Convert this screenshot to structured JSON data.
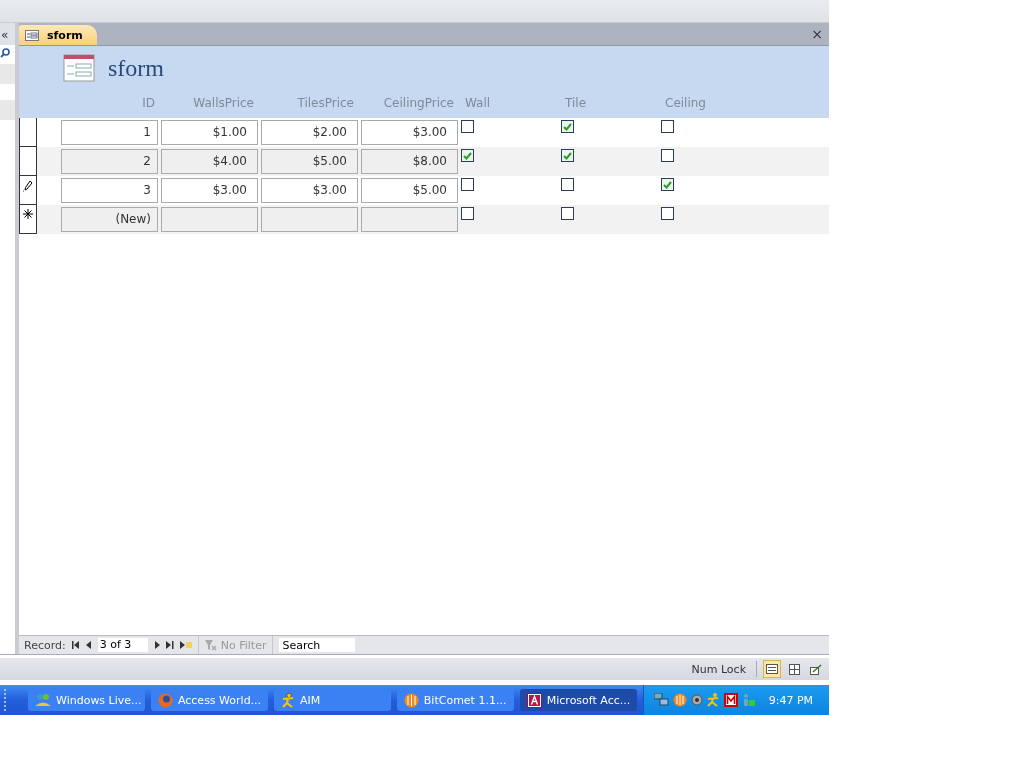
{
  "nav_pane": {
    "collapse": "«"
  },
  "document_tab": {
    "label": "sform",
    "selected": true,
    "close": "×"
  },
  "form": {
    "title": "sform",
    "columns": [
      "ID",
      "WallsPrice",
      "TilesPrice",
      "CeilingPrice",
      "Wall",
      "Tile",
      "Ceiling"
    ],
    "rows": [
      {
        "editing": false,
        "new_record": false,
        "id": "1",
        "walls_price": "$1.00",
        "tiles_price": "$2.00",
        "ceiling_price": "$3.00",
        "wall": false,
        "tile": true,
        "ceiling": false
      },
      {
        "editing": false,
        "new_record": false,
        "id": "2",
        "walls_price": "$4.00",
        "tiles_price": "$5.00",
        "ceiling_price": "$8.00",
        "wall": true,
        "tile": true,
        "ceiling": false
      },
      {
        "editing": true,
        "new_record": false,
        "id": "3",
        "walls_price": "$3.00",
        "tiles_price": "$3.00",
        "ceiling_price": "$5.00",
        "wall": false,
        "tile": false,
        "ceiling": true
      },
      {
        "editing": false,
        "new_record": true,
        "id": "(New)",
        "walls_price": "",
        "tiles_price": "",
        "ceiling_price": "",
        "wall": false,
        "tile": false,
        "ceiling": false
      }
    ]
  },
  "record_nav": {
    "label": "Record:",
    "current": "3 of 3",
    "filter": "No Filter",
    "filter_disabled": true,
    "search_placeholder": "Search"
  },
  "status_bar": {
    "num_lock": "Num Lock",
    "views": [
      {
        "kind": "form",
        "selected": true
      },
      {
        "kind": "layout",
        "selected": false
      },
      {
        "kind": "design",
        "selected": false
      }
    ]
  },
  "taskbar": {
    "items": [
      {
        "kind": "messenger",
        "label": "Windows Live...",
        "selected": false
      },
      {
        "kind": "browser",
        "label": "Access World...",
        "selected": false
      },
      {
        "kind": "aim",
        "label": "AIM",
        "selected": false
      },
      {
        "kind": "comet",
        "label": "BitComet 1.1...",
        "selected": false
      },
      {
        "kind": "access",
        "label": "Microsoft Acc...",
        "selected": true
      }
    ],
    "clock": "9:47 PM"
  }
}
